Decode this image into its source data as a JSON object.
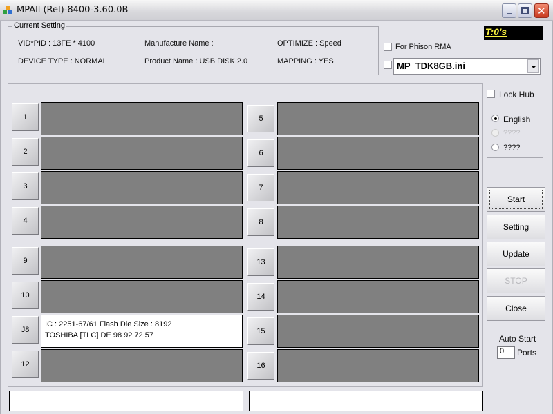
{
  "window": {
    "title": "MPAll (Rel)-8400-3.60.0B",
    "controls": {
      "minimize": "minimize",
      "maximize": "maximize",
      "close": "✕"
    }
  },
  "current_setting": {
    "label": "Current Setting",
    "vid_pid": "VID*PID : 13FE * 4100",
    "device_type": "DEVICE TYPE : NORMAL",
    "manufacture_name": "Manufacture Name :",
    "product_name": "Product Name : USB DISK 2.0",
    "optimize": "OPTIMIZE : Speed",
    "mapping": "MAPPING : YES"
  },
  "timer": "T:0's",
  "phison_rma": {
    "label": "For Phison RMA",
    "checked": false
  },
  "ini_file": {
    "checked": false,
    "value": "MP_TDK8GB.ini"
  },
  "lock_hub": {
    "label": "Lock Hub",
    "checked": false
  },
  "language": {
    "options": [
      {
        "label": "English",
        "selected": true,
        "enabled": true
      },
      {
        "label": "????",
        "selected": false,
        "enabled": false
      },
      {
        "label": "????",
        "selected": false,
        "enabled": true
      }
    ]
  },
  "ports": {
    "left": [
      {
        "label": "1",
        "info": [
          "",
          ""
        ]
      },
      {
        "label": "2",
        "info": [
          "",
          ""
        ]
      },
      {
        "label": "3",
        "info": [
          "",
          ""
        ]
      },
      {
        "label": "4",
        "info": [
          "",
          ""
        ]
      },
      {
        "label": "9",
        "info": [
          "",
          ""
        ]
      },
      {
        "label": "10",
        "info": [
          "",
          ""
        ]
      },
      {
        "label": "J8",
        "info": [
          "IC : 2251-67/61  Flash Die Size : 8192",
          "TOSHIBA [TLC] DE 98 92 72 57"
        ]
      },
      {
        "label": "12",
        "info": [
          "",
          ""
        ]
      }
    ],
    "right": [
      {
        "label": "5"
      },
      {
        "label": "6"
      },
      {
        "label": "7"
      },
      {
        "label": "8"
      },
      {
        "label": "13"
      },
      {
        "label": "14"
      },
      {
        "label": "15"
      },
      {
        "label": "16"
      }
    ]
  },
  "actions": {
    "start": "Start",
    "setting": "Setting",
    "update": "Update",
    "stop": "STOP",
    "close": "Close"
  },
  "auto_start": {
    "label": "Auto Start",
    "value": "0",
    "unit": "Ports"
  },
  "status_bar": {
    "left": "",
    "right": ""
  }
}
